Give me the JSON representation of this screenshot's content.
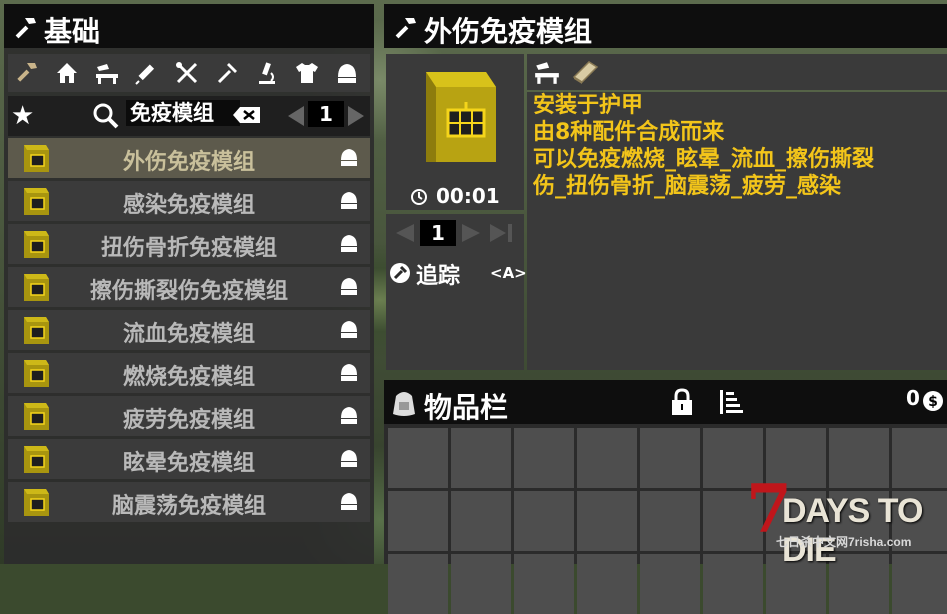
{
  "left_panel": {
    "title": "基础",
    "categories": [
      "hammer-icon",
      "house-icon",
      "workbench-icon",
      "syringe-icon",
      "tools-icon",
      "fork-icon",
      "microscope-icon",
      "shirt-icon",
      "helmet-icon"
    ],
    "search": {
      "value": "免疫模组",
      "page": "1"
    },
    "recipes": [
      {
        "label": "外伤免疫模组",
        "selected": true
      },
      {
        "label": "感染免疫模组"
      },
      {
        "label": "扭伤骨折免疫模组"
      },
      {
        "label": "擦伤撕裂伤免疫模组"
      },
      {
        "label": "流血免疫模组"
      },
      {
        "label": "燃烧免疫模组"
      },
      {
        "label": "疲劳免疫模组"
      },
      {
        "label": "眩晕免疫模组"
      },
      {
        "label": "脑震荡免疫模组"
      }
    ]
  },
  "detail": {
    "title": "外伤免疫模组",
    "craft_time": "00:01",
    "quantity": "1",
    "track_label": "追踪",
    "track_key": "<A>",
    "description": [
      "安装于护甲",
      "由8种配件合成而来",
      "可以免疫燃烧_眩晕_流血_擦伤撕裂",
      "伤_扭伤骨折_脑震荡_疲劳_感染"
    ]
  },
  "inventory": {
    "title": "物品栏",
    "coins": "0"
  },
  "logo": {
    "seven": "7",
    "text": "DAYS TO DIE",
    "sub": "七日杀中文网7risha.com"
  },
  "colors": {
    "accent_yellow": "#f3c51a",
    "header_bg": "#0e0e0e",
    "logo_red": "#c0161b"
  }
}
